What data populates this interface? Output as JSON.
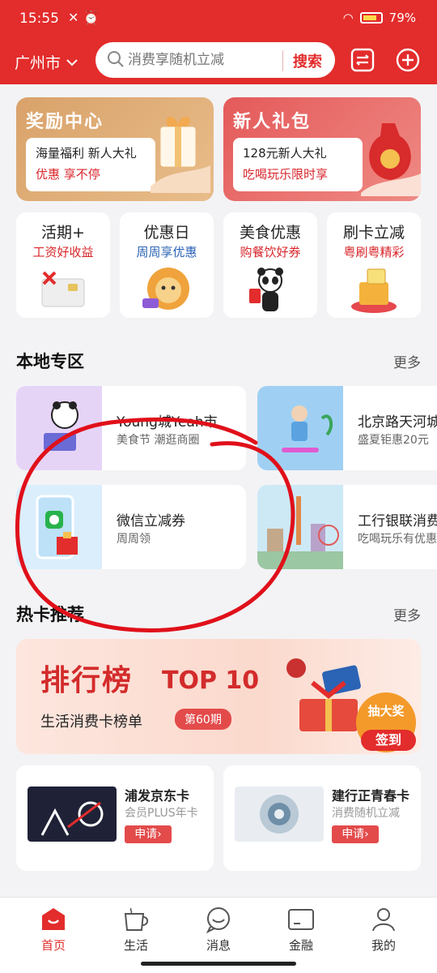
{
  "status_bar": {
    "time": "15:55",
    "battery": "79%"
  },
  "header": {
    "city": "广州市",
    "search": {
      "placeholder": "消费享随机立减",
      "button": "搜索"
    }
  },
  "promo_cards": [
    {
      "title": "奖励中心",
      "line1": "海量福利 新人大礼",
      "line2": "优惠 享不停"
    },
    {
      "title": "新人礼包",
      "line1": "128元新人大礼",
      "line2": "吃喝玩乐限时享"
    }
  ],
  "features": [
    {
      "title": "活期+",
      "subtitle": "工资好收益",
      "sub_color": "#d8262b"
    },
    {
      "title": "优惠日",
      "subtitle": "周周享优惠",
      "sub_color": "#2b63b5"
    },
    {
      "title": "美食优惠",
      "subtitle": "购餐饮好券",
      "sub_color": "#d8262b"
    },
    {
      "title": "刷卡立减",
      "subtitle": "粤刷粤精彩",
      "sub_color": "#d8262b"
    }
  ],
  "local_section": {
    "title": "本地专区",
    "more": "更多",
    "cards": [
      {
        "title": "Young城Yeah市",
        "subtitle": "美食节 潮逛商圈"
      },
      {
        "title": "北京路天河城",
        "subtitle": "盛夏钜惠20元"
      },
      {
        "title": "微信立减券",
        "subtitle": "周周领"
      },
      {
        "title": "工行银联消费",
        "subtitle": "吃喝玩乐有优惠"
      }
    ]
  },
  "hot_cards_section": {
    "title": "热卡推荐",
    "more": "更多",
    "banner": {
      "headline": "排行榜",
      "top": "TOP 10",
      "subtitle": "生活消费卡榜单",
      "period": "第60期",
      "lottery": "抽大奖",
      "checkin": "签到"
    },
    "cards": [
      {
        "name": "浦发京东卡",
        "desc": "会员PLUS年卡",
        "apply": "申请›"
      },
      {
        "name": "建行正青春卡",
        "desc": "消费随机立减",
        "apply": "申请›"
      }
    ]
  },
  "bottom_nav": [
    {
      "label": "首页",
      "active": true
    },
    {
      "label": "生活",
      "active": false
    },
    {
      "label": "消息",
      "active": false
    },
    {
      "label": "金融",
      "active": false
    },
    {
      "label": "我的",
      "active": false
    }
  ],
  "colors": {
    "brand_red": "#e32c2c",
    "annotation_red": "#e0101a"
  }
}
